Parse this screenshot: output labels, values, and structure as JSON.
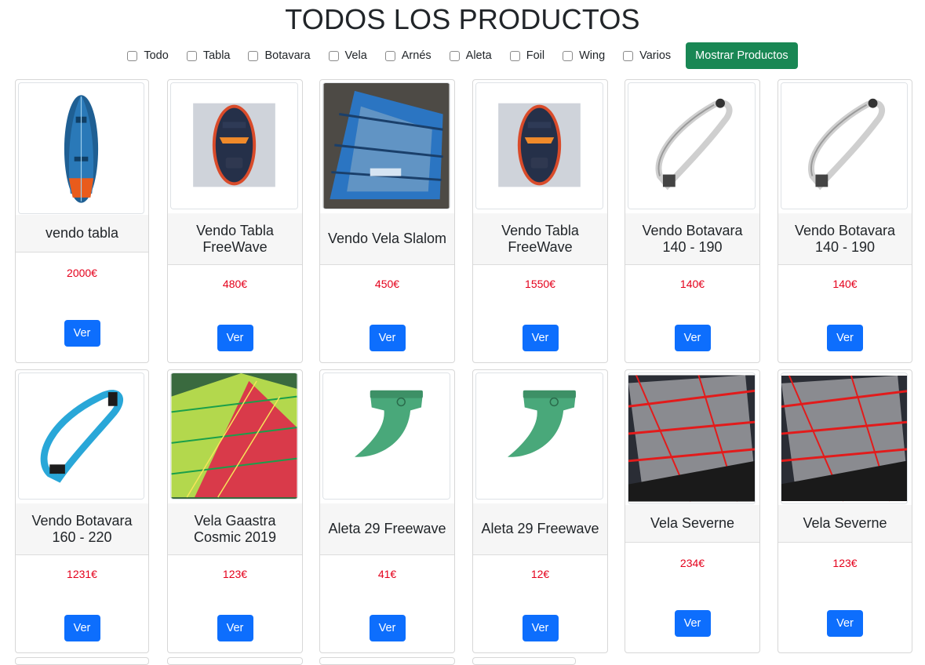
{
  "page": {
    "title": "TODOS LOS PRODUCTOS"
  },
  "filters": {
    "options": [
      "Todo",
      "Tabla",
      "Botavara",
      "Vela",
      "Arnés",
      "Aleta",
      "Foil",
      "Wing",
      "Varios"
    ],
    "submit_label": "Mostrar Productos"
  },
  "products": [
    {
      "name": "vendo tabla",
      "price": "2000€",
      "button": "Ver",
      "image": "board-icon"
    },
    {
      "name": "Vendo Tabla FreeWave",
      "price": "480€",
      "button": "Ver",
      "image": "board-icon"
    },
    {
      "name": "Vendo Vela Slalom",
      "price": "450€",
      "button": "Ver",
      "image": "sail-icon"
    },
    {
      "name": "Vendo Tabla FreeWave",
      "price": "1550€",
      "button": "Ver",
      "image": "board-icon"
    },
    {
      "name": "Vendo Botavara 140 - 190",
      "price": "140€",
      "button": "Ver",
      "image": "boom-icon"
    },
    {
      "name": "Vendo Botavara 140 - 190",
      "price": "140€",
      "button": "Ver",
      "image": "boom-icon"
    },
    {
      "name": "Vendo Botavara 160 - 220",
      "price": "1231€",
      "button": "Ver",
      "image": "boom-icon"
    },
    {
      "name": "Vela Gaastra Cosmic 2019",
      "price": "123€",
      "button": "Ver",
      "image": "sail-icon"
    },
    {
      "name": "Aleta 29 Freewave",
      "price": "41€",
      "button": "Ver",
      "image": "fin-icon"
    },
    {
      "name": "Aleta 29 Freewave",
      "price": "12€",
      "button": "Ver",
      "image": "fin-icon"
    },
    {
      "name": "Vela Severne",
      "price": "234€",
      "button": "Ver",
      "image": "sail-icon"
    },
    {
      "name": "Vela Severne",
      "price": "123€",
      "button": "Ver",
      "image": "sail-icon"
    }
  ]
}
